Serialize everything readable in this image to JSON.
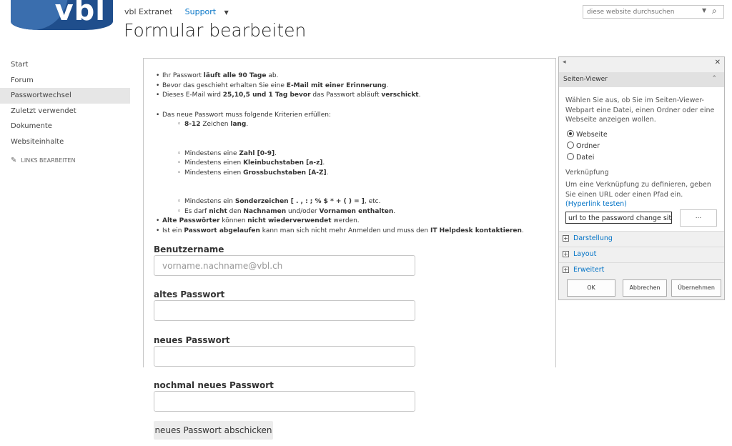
{
  "header": {
    "logo_text": "vbl",
    "site_name": "vbl Extranet",
    "support_label": "Support",
    "page_title": "Formular bearbeiten",
    "search_placeholder": "diese website durchsuchen"
  },
  "leftnav": {
    "items": [
      "Start",
      "Forum",
      "Passwortwechsel",
      "Zuletzt verwendet",
      "Dokumente",
      "Websiteinhalte"
    ],
    "active_item": "Passwortwechsel",
    "edit_links_label": "LINKS BEARBEITEN"
  },
  "info": {
    "l1_a": "Ihr Passwort ",
    "l1_b": "läuft alle 90 Tage",
    "l1_c": " ab.",
    "l2_a": "Bevor das geschieht erhalten Sie eine ",
    "l2_b": "E-Mail mit einer Erinnerung",
    "l2_c": ".",
    "l3_a": "Dieses E-Mail wird ",
    "l3_b": "25,10,5 und 1 Tag bevor",
    "l3_c": " das Passwort abläuft ",
    "l3_d": "verschickt",
    "l3_e": ".",
    "l4": "Das neue Passwort muss folgende Kriterien erfüllen:",
    "s1_a": "8-12",
    "s1_b": " Zeichen ",
    "s1_c": "lang",
    "s1_d": ".",
    "s2_a": "Mindestens eine ",
    "s2_b": "Zahl [0-9]",
    "s2_c": ".",
    "s3_a": "Mindestens einen ",
    "s3_b": "Kleinbuchstaben [a-z]",
    "s3_c": ".",
    "s4_a": "Mindestens einen ",
    "s4_b": "Grossbuchstaben [A-Z]",
    "s4_c": ".",
    "s5_a": "Mindestens ein ",
    "s5_b": "Sonderzeichen [ . , : ; % $ * + ( ) = ]",
    "s5_c": ", etc.",
    "s6_a": "Es darf ",
    "s6_b": "nicht",
    "s6_c": " den ",
    "s6_d": "Nachnamen",
    "s6_e": " und/oder ",
    "s6_f": "Vornamen enthalten",
    "s6_g": ".",
    "l5_a": "Alte Passwörter",
    "l5_b": " können ",
    "l5_c": "nicht wiederverwendet",
    "l5_d": " werden.",
    "l6_a": "Ist ein ",
    "l6_b": "Passwort abgelaufen",
    "l6_c": " kann man sich nicht mehr Anmelden und muss den ",
    "l6_d": "IT Helpdesk kontaktieren",
    "l6_e": "."
  },
  "form": {
    "username_label": "Benutzername",
    "username_placeholder": "vorname.nachname@vbl.ch",
    "old_pw_label": "altes Passwort",
    "new_pw_label": "neues Passwort",
    "repeat_pw_label": "nochmal neues Passwort",
    "submit_label": "neues Passwort abschicken"
  },
  "panel": {
    "section_title": "Seiten-Viewer",
    "description": "Wählen Sie aus, ob Sie im Seiten-Viewer-Webpart eine Datei, einen Ordner oder eine Webseite anzeigen wollen.",
    "options": [
      "Webseite",
      "Ordner",
      "Datei"
    ],
    "selected_option": "Webseite",
    "link_label": "Verknüpfung",
    "link_desc": "Um eine Verknüpfung zu definieren, geben Sie einen URL oder einen Pfad ein. ",
    "link_test": "(Hyperlink testen)",
    "url_value": "url to the password change site",
    "browse_label": "...",
    "expanders": [
      "Darstellung",
      "Layout",
      "Erweitert"
    ],
    "ok_label": "OK",
    "cancel_label": "Abbrechen",
    "apply_label": "Übernehmen"
  }
}
